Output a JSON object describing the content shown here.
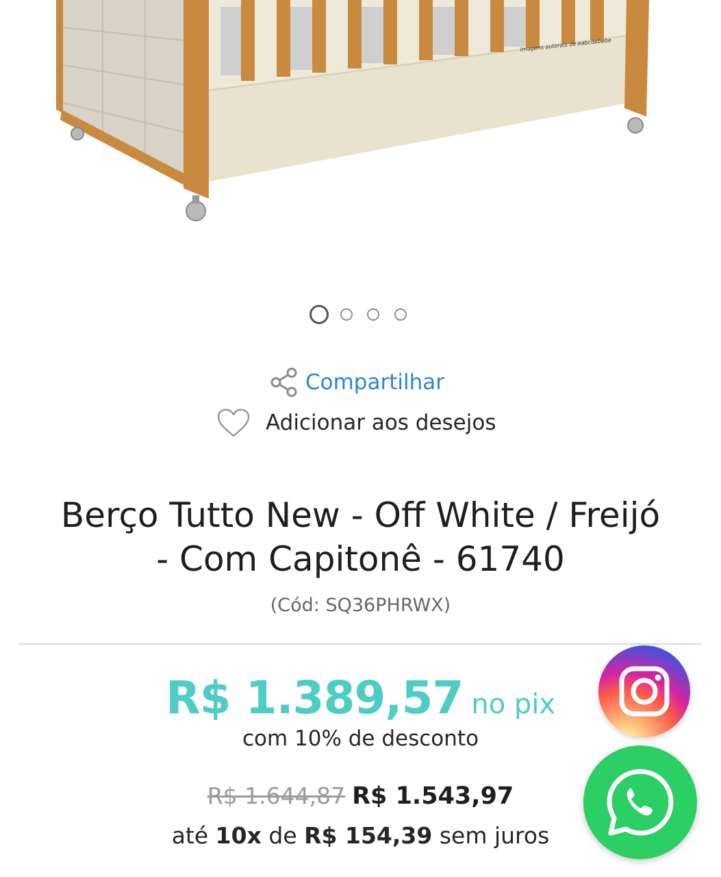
{
  "gallery": {
    "watermark": "Imagens autorais de eabcdebebe",
    "active_index": 0,
    "dot_count": 4
  },
  "actions": {
    "share_label": "Compartilhar",
    "wishlist_label": "Adicionar aos desejos",
    "share_icon": "share-icon",
    "wishlist_icon": "heart-outline-icon"
  },
  "product": {
    "title_line1": "Berço Tutto New - Off White / Freijó",
    "title_line2": "- Com Capitonê - 61740",
    "code": "(Cód: SQ36PHRWX)"
  },
  "pricing": {
    "pix_price": "R$ 1.389,57",
    "pix_suffix": "no pix",
    "pix_discount": "com 10% de desconto",
    "old_price": "R$ 1.644,87",
    "price": "R$ 1.543,97",
    "installments_prefix": "até",
    "installments_count": "10x",
    "installments_de": "de",
    "installment_value": "R$ 154,39",
    "installments_suffix": "sem juros"
  },
  "floating": {
    "instagram_icon": "instagram-icon",
    "whatsapp_icon": "whatsapp-icon"
  },
  "colors": {
    "pix_accent": "#4ecdc4",
    "link_blue": "#2a86d8",
    "whatsapp_green": "#2ccf63"
  }
}
